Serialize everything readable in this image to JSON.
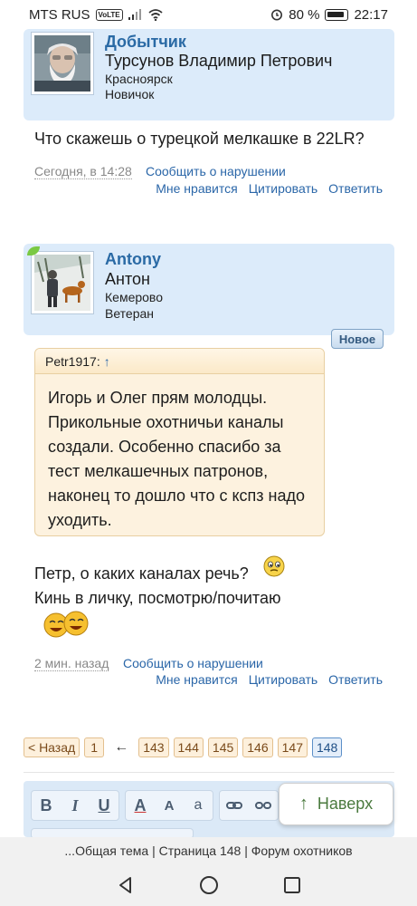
{
  "status_bar": {
    "carrier": "MTS RUS",
    "volte": "VoLTE",
    "battery_percent": "80 %",
    "time": "22:17"
  },
  "post1": {
    "username": "Добытчик",
    "real_name": "Турсунов Владимир Петрович",
    "city": "Красноярск",
    "rank": "Новичок",
    "text": "Что скажешь о турецкой мелкашке в 22LR?",
    "time": "Сегодня, в 14:28",
    "report": "Сообщить о нарушении",
    "actions": {
      "like": "Мне нравится",
      "quote": "Цитировать",
      "reply": "Ответить"
    }
  },
  "post2": {
    "username": "Antony",
    "real_name": "Антон",
    "city": "Кемерово",
    "rank": "Ветеран",
    "badge": "Новое",
    "quote_author": "Petr1917:",
    "quote_arrow": "↑",
    "quote_lines": [
      "Игорь и Олег прям молодцы.",
      "Прикольные охотничьи каналы",
      "создали. Особенно спасибо за",
      "тест мелкашечных патронов,",
      "наконец то дошло что с кспз надо",
      "уходить."
    ],
    "text_lines": [
      "Петр, о каких каналах речь?",
      "Кинь в личку, посмотрю/почитаю"
    ],
    "time": "2 мин. назад",
    "report": "Сообщить о нарушении",
    "actions": {
      "like": "Мне нравится",
      "quote": "Цитировать",
      "reply": "Ответить"
    }
  },
  "pagination": {
    "back": "< Назад",
    "first": "1",
    "ellipsis_arrow": "←",
    "pages": [
      "143",
      "144",
      "145",
      "146",
      "147"
    ],
    "current": "148"
  },
  "editor": {
    "bold": "B",
    "italic": "I",
    "underline": "U",
    "font_color": "A",
    "font_size": "A",
    "font_face": "a",
    "link_icon": "link-icon",
    "unlink_icon": "unlink-icon"
  },
  "to_top_button": {
    "arrow": "↑",
    "label": "Наверх"
  },
  "browser_title": "...Общая тема | Страница 148 | Форум охотников"
}
